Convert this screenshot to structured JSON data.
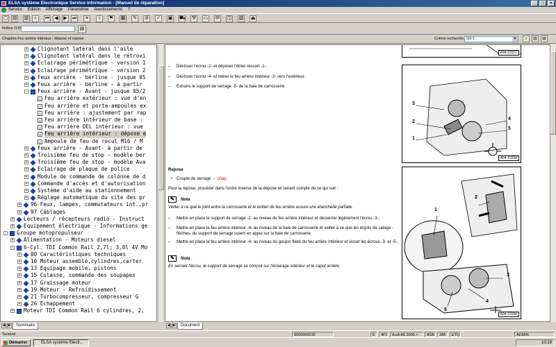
{
  "window": {
    "title": "ELSA système Electronique Service information - [Manuel de réparation]",
    "controls": [
      "_",
      "□",
      "×"
    ]
  },
  "menu": [
    "Service",
    "Edition",
    "Affichage",
    "Paramétrer",
    "Avertissements",
    "?"
  ],
  "notice": {
    "label": "Notice O.R.:",
    "value": ""
  },
  "chapter": {
    "text": "Chapitre:Feu arrière intérieur : dépose et repose",
    "criteria_label": "Critère recherche:",
    "criteria_value": "G6-1"
  },
  "tree": {
    "rows": [
      {
        "lvl": 4,
        "pm": "+",
        "icon": "cube",
        "text": "Clignotant latéral dans l'aile"
      },
      {
        "lvl": 4,
        "pm": "+",
        "icon": "cube",
        "text": "Clignotant latéral dans le rétrovi"
      },
      {
        "lvl": 4,
        "pm": "+",
        "icon": "cube",
        "text": "Eclairage périmétrique - version 1"
      },
      {
        "lvl": 4,
        "pm": "+",
        "icon": "cube",
        "text": "Eclairage périmétrique - version 2"
      },
      {
        "lvl": 4,
        "pm": "+",
        "icon": "cube",
        "text": "Feux arrière - berline - jusque 05"
      },
      {
        "lvl": 4,
        "pm": "+",
        "icon": "cube",
        "text": "Feux arrière - berline - à partir"
      },
      {
        "lvl": 4,
        "pm": "-",
        "icon": "book",
        "text": "Feux arrière - Avant - jusque 05/2"
      },
      {
        "lvl": 5,
        "pm": "",
        "icon": "page",
        "text": "Feu arrière extérieur : vue d'en"
      },
      {
        "lvl": 5,
        "pm": "",
        "icon": "page",
        "text": "Feu arrière et porte-ampoules ex"
      },
      {
        "lvl": 5,
        "pm": "",
        "icon": "page",
        "text": "Feu arrière : ajustement par rap"
      },
      {
        "lvl": 5,
        "pm": "",
        "icon": "page",
        "text": "Feu arrière intérieur de base :"
      },
      {
        "lvl": 5,
        "pm": "",
        "icon": "page",
        "text": "Feu arrière DEL intérieur : vue"
      },
      {
        "lvl": 5,
        "pm": "",
        "icon": "page",
        "text": "Feu arrière intérieur : dépose e",
        "selected": true
      },
      {
        "lvl": 5,
        "pm": "",
        "icon": "page",
        "text": "Ampoule de feu de recul  M16 / M"
      },
      {
        "lvl": 4,
        "pm": "+",
        "icon": "cube",
        "text": "Feux arrière - Avant- à partir de"
      },
      {
        "lvl": 4,
        "pm": "+",
        "icon": "cube",
        "text": "Troisième feu de stop - modèle ber"
      },
      {
        "lvl": 4,
        "pm": "+",
        "icon": "cube",
        "text": "Troisième feu de stop - modèle Ava"
      },
      {
        "lvl": 4,
        "pm": "+",
        "icon": "cube",
        "text": "Eclairage de plaque de police"
      },
      {
        "lvl": 4,
        "pm": "+",
        "icon": "cube",
        "text": "Module de commande de colonne de d"
      },
      {
        "lvl": 4,
        "pm": "+",
        "icon": "cube",
        "text": "Commande d'accès et d'autorisation"
      },
      {
        "lvl": 4,
        "pm": "+",
        "icon": "cube",
        "text": "Système d'aide au stationnement"
      },
      {
        "lvl": 4,
        "pm": "+",
        "icon": "cube",
        "text": "Réglage automatique du site des pr"
      },
      {
        "lvl": 3,
        "pm": "+",
        "icon": "cube",
        "text": "96 Feux, lampes, commutateurs int.,pr"
      },
      {
        "lvl": 3,
        "pm": "+",
        "icon": "cube",
        "text": "97 Câblages"
      },
      {
        "lvl": 2,
        "pm": "+",
        "icon": "cube",
        "text": "Lecteurs / récepteurs radio - Instruct"
      },
      {
        "lvl": 2,
        "pm": "+",
        "icon": "cube",
        "text": "Equipement électrique - Informations ge"
      },
      {
        "lvl": 1,
        "pm": "-",
        "icon": "book",
        "text": "Groupe motopropulseur"
      },
      {
        "lvl": 2,
        "pm": "+",
        "icon": "cube",
        "text": "Alimentation - Moteurs diesel"
      },
      {
        "lvl": 2,
        "pm": "-",
        "icon": "book",
        "text": "6-Cyl. TDI Common Rail 2,7l; 3,0l 4V Mo"
      },
      {
        "lvl": 3,
        "pm": "+",
        "icon": "cube",
        "text": "00 Caractéristiques techniques"
      },
      {
        "lvl": 3,
        "pm": "+",
        "icon": "cube",
        "text": "10 Moteur assemblé,cylindres,carter"
      },
      {
        "lvl": 3,
        "pm": "+",
        "icon": "cube",
        "text": "13 Equipage mobile, pistons"
      },
      {
        "lvl": 3,
        "pm": "+",
        "icon": "cube",
        "text": "15 Culasse, commande des soupapes"
      },
      {
        "lvl": 3,
        "pm": "+",
        "icon": "cube",
        "text": "17 Graissage moteur"
      },
      {
        "lvl": 3,
        "pm": "+",
        "icon": "cube",
        "text": "19 Moteur - Refroidissement"
      },
      {
        "lvl": 3,
        "pm": "+",
        "icon": "cube",
        "text": "21 Turbocompresseur, compresseur G"
      },
      {
        "lvl": 3,
        "pm": "+",
        "icon": "cube",
        "text": "26 Echappement"
      },
      {
        "lvl": 2,
        "pm": "+",
        "icon": "book",
        "text": "Moteur TDI Common Rail 6 cylindres, 2,"
      }
    ]
  },
  "tree_tab": "Sommaire",
  "doc_tab": "Document",
  "doc": {
    "steps_top": [
      "Dévisser l'écrou -2- et déposer l'étrier-ressort -1-.",
      "Dévisser l'écrou -4- et retirer le feu arrière intérieur -3- vers l'extérieur.",
      "Extraire le support de serrage -5- de la baie de carrosserie."
    ],
    "repose_heading": "Repose",
    "couple": "Couple de serrage",
    "couple_link": "→ chap.",
    "intro": "Pour la repose, procéder dans l'ordre inverse de la dépose en tenant compte de ce qui suit :",
    "note1_label": "Nota",
    "note1_text": "Veiller à ce que le joint entre la carrosserie et le boîtier de feu arrière assure une étanchéité parfaite.",
    "steps_repose": [
      "Mettre en place le support de serrage -2- au niveau du feu arrière intérieur et desserrer légèrement l'écrou -3-.",
      "Mettre en place le feu arrière intérieur -4- au niveau de la baie de carrosserie et veiller à ce que les ergots de calage -flèches- du support de serrage soient en appui sur la baie de carrosserie.",
      "Mettre en place le feu arrière intérieur -4- au niveau du goujon fileté du feu arrière intérieur et visser les écrous -3- et -5-."
    ],
    "note2_label": "Nota",
    "note2_text": "En serrant l'écrou, le support de serrage se conçoit sur l'éclairage intérieur et le capot arrière.",
    "fig1_id": "A94-10157",
    "fig2_id": "A94-10158",
    "fig3_id": "A94-10166",
    "fig2_labels": [
      "3",
      "2",
      "1",
      "4",
      "5"
    ],
    "fig3_labels": [
      "1",
      "2",
      "3",
      "4",
      "5"
    ]
  },
  "status": {
    "left": "Terminé",
    "code": "9000000030",
    "f1": "8",
    "f2": "4F2",
    "f3": "Audi A6 2005 >",
    "f4": "ASB",
    "f5": "JAF",
    "f6": "ETQ",
    "user": "ADMIN"
  },
  "taskbar": {
    "start": "Démarrer",
    "item": "ELSA système Electr...",
    "clock": "10:19"
  }
}
